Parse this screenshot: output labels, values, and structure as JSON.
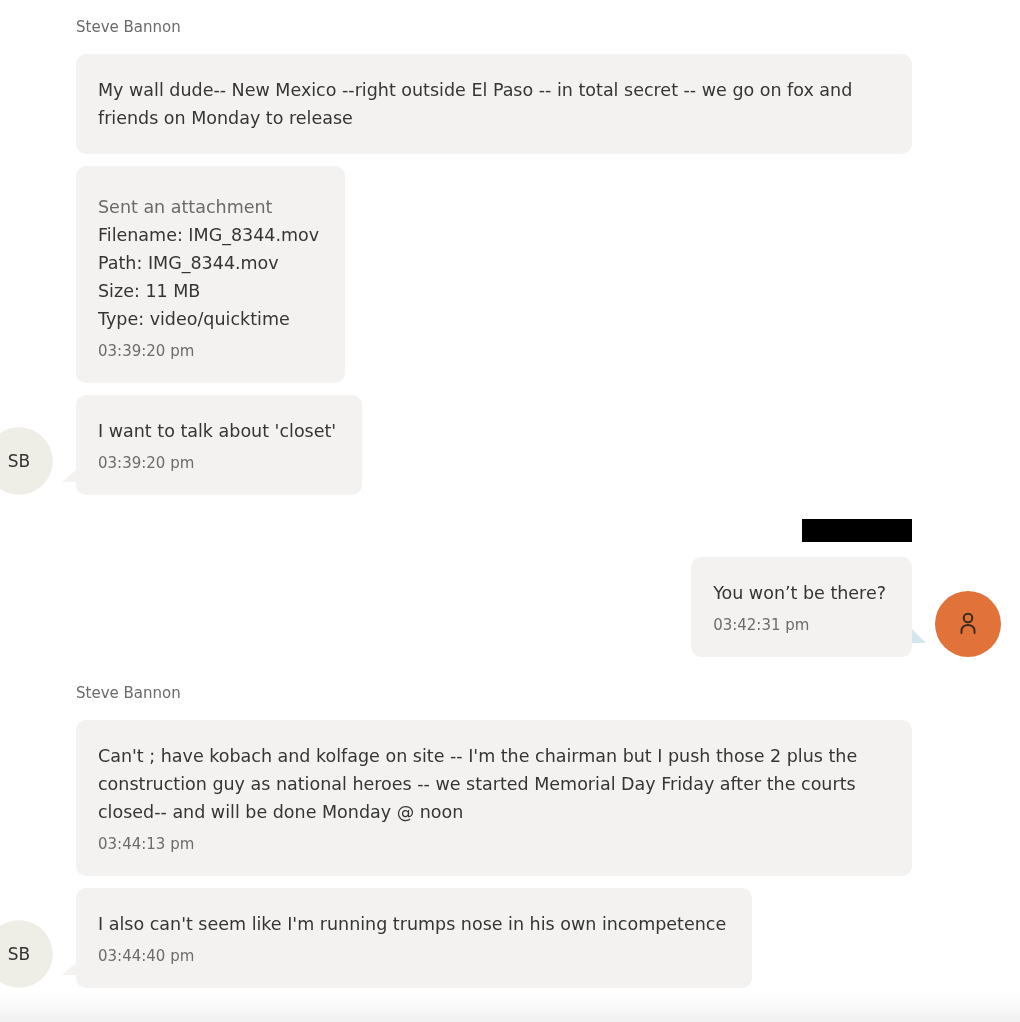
{
  "thread": [
    {
      "kind": "incoming",
      "sender": "Steve Bannon",
      "avatar": "SB",
      "bubbles": [
        {
          "kind": "text",
          "text": "My wall dude-- New Mexico --right outside El Paso -- in total secret -- we go on fox and friends on Monday to release"
        },
        {
          "kind": "attachment",
          "caption": "Sent an attachment",
          "details": [
            "Filename: IMG_8344.mov",
            "Path: IMG_8344.mov",
            "Size: 11 MB",
            "Type: video/quicktime"
          ],
          "time": "03:39:20 pm"
        },
        {
          "kind": "text",
          "text": "I want to talk about 'closet'",
          "time": "03:39:20 pm"
        }
      ]
    },
    {
      "kind": "outgoing",
      "sender_redacted": true,
      "bubbles": [
        {
          "kind": "text",
          "text": "You won’t be there?",
          "time": "03:42:31 pm"
        }
      ]
    },
    {
      "kind": "incoming",
      "sender": "Steve Bannon",
      "avatar": "SB",
      "bubbles": [
        {
          "kind": "text",
          "text": "Can't ; have kobach and kolfage on site -- I'm the chairman but I push those 2 plus the construction guy as national heroes -- we started Memorial Day Friday after the courts closed-- and will be done Monday @ noon",
          "time": "03:44:13 pm"
        },
        {
          "kind": "text",
          "text": "I also can't seem like I'm running trumps nose in his own incompetence",
          "time": "03:44:40 pm"
        }
      ]
    }
  ]
}
